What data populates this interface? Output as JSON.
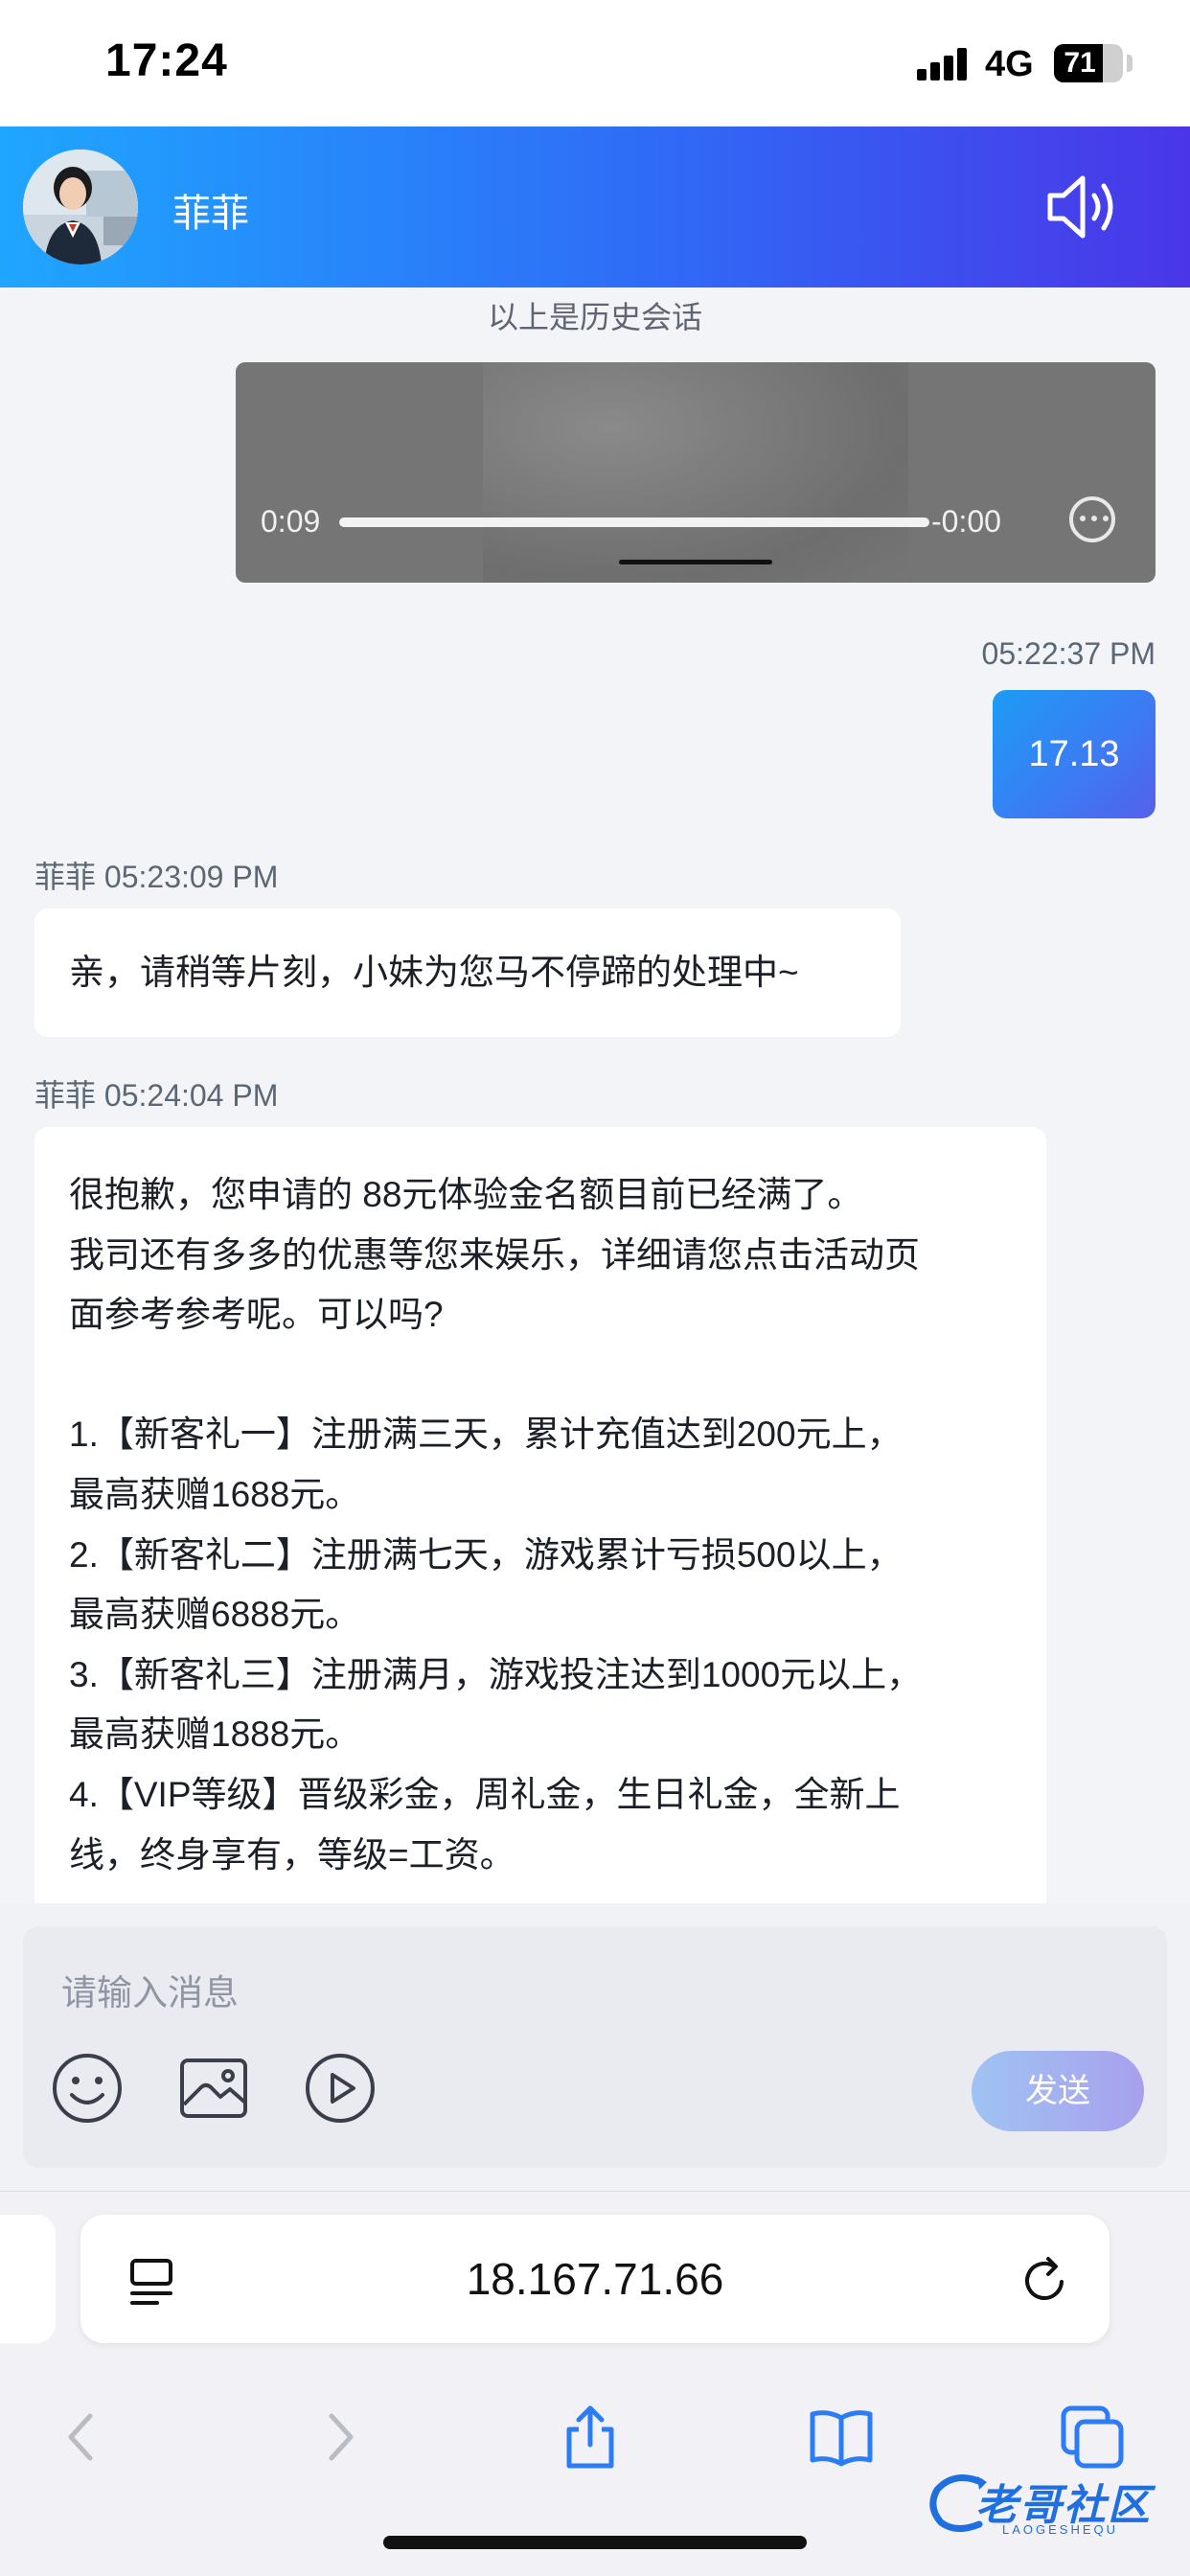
{
  "status_bar": {
    "time": "17:24",
    "network": "4G",
    "battery": "71",
    "battery_level": 0.71
  },
  "header": {
    "contact_name": "菲菲",
    "speaker_icon": "speaker-icon",
    "avatar": "agent-avatar"
  },
  "chat": {
    "history_note": "以上是历史会话",
    "video": {
      "elapsed": "0:09",
      "remaining": "-0:00",
      "progress": 1.0,
      "more_icon": "ellipsis-circle-icon"
    },
    "user_message": {
      "timestamp": "05:22:37 PM",
      "text": "17.13"
    },
    "agent_messages": [
      {
        "sender": "菲菲",
        "timestamp": "05:23:09 PM",
        "lines": [
          "亲，请稍等片刻，小妹为您马不停蹄的处理中~"
        ]
      },
      {
        "sender": "菲菲",
        "timestamp": "05:24:04 PM",
        "lines": [
          "很抱歉，您申请的 88元体验金名额目前已经满了。",
          "我司还有多多的优惠等您来娱乐，详细请您点击活动页",
          "面参考参考呢。可以吗?",
          "",
          "1.【新客礼一】注册满三天，累计充值达到200元上，",
          "最高获赠1688元。",
          "2.【新客礼二】注册满七天，游戏累计亏损500以上，",
          "最高获赠6888元。",
          "3.【新客礼三】注册满月，游戏投注达到1000元以上，",
          "最高获赠1888元。",
          "4.【VIP等级】晋级彩金，周礼金，生日礼金，全新上",
          "线，终身享有，等级=工资。",
          "…"
        ]
      }
    ]
  },
  "composer": {
    "placeholder": "请输入消息",
    "send_label": "发送",
    "tools": [
      "emoji-icon",
      "image-icon",
      "video-play-icon"
    ]
  },
  "browser": {
    "url": "18.167.71.66",
    "icons": [
      "reader-icon",
      "reload-icon",
      "back-icon",
      "forward-icon",
      "share-icon",
      "bookmarks-icon",
      "tabs-icon"
    ]
  },
  "watermark": {
    "text": "老哥社区",
    "sub": "LAOGESHEQU"
  },
  "colors": {
    "header_start": "#1fa6ff",
    "header_end": "#4a36e8",
    "chat_bg": "#f3f4f8",
    "send_button": "#a8b8f0"
  }
}
